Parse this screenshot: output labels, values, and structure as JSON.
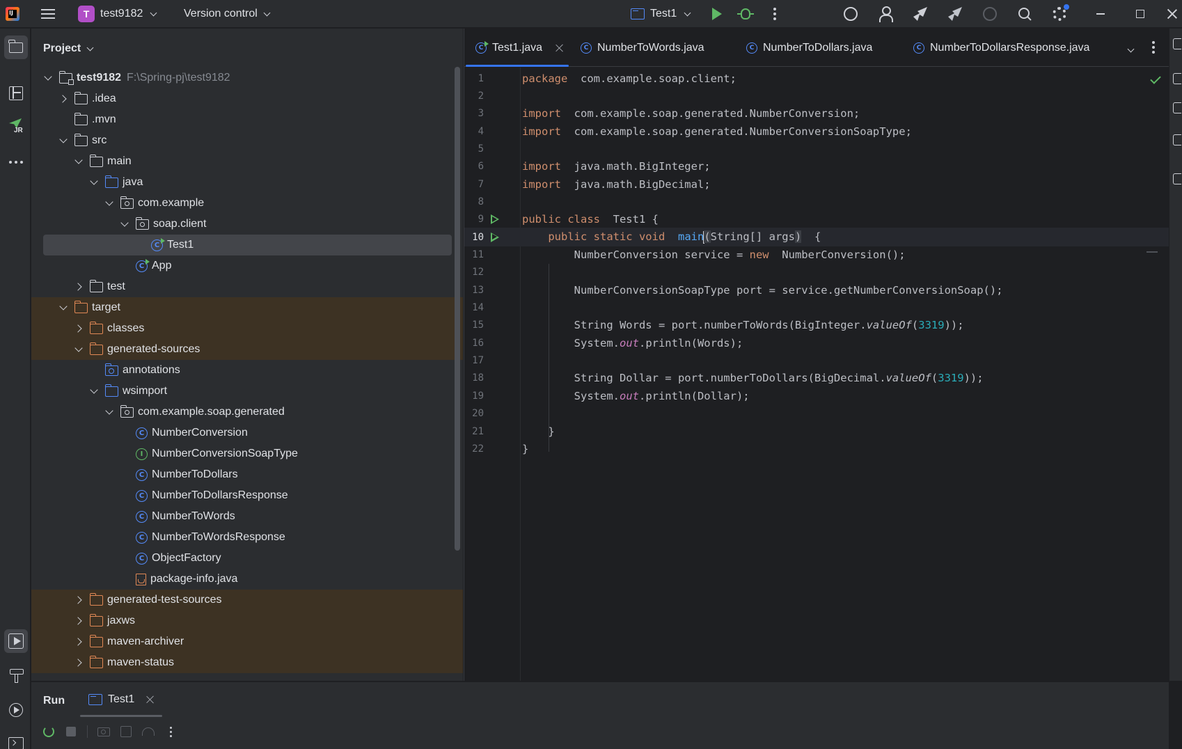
{
  "titlebar": {
    "project_initial": "T",
    "project_name": "test9182",
    "vcs_label": "Version control",
    "run_config": "Test1"
  },
  "project_panel": {
    "title": "Project",
    "tree": [
      {
        "label": "test9182",
        "path": "F:\\Spring-pj\\test9182",
        "depth": 0,
        "arrow": "down",
        "icon": "project-folder",
        "bold": true
      },
      {
        "label": ".idea",
        "depth": 1,
        "arrow": "right",
        "icon": "folder"
      },
      {
        "label": ".mvn",
        "depth": 1,
        "arrow": "none",
        "icon": "folder"
      },
      {
        "label": "src",
        "depth": 1,
        "arrow": "down",
        "icon": "folder"
      },
      {
        "label": "main",
        "depth": 2,
        "arrow": "down",
        "icon": "folder"
      },
      {
        "label": "java",
        "depth": 3,
        "arrow": "down",
        "icon": "source-folder"
      },
      {
        "label": "com.example",
        "depth": 4,
        "arrow": "down",
        "icon": "package"
      },
      {
        "label": "soap.client",
        "depth": 5,
        "arrow": "down",
        "icon": "package"
      },
      {
        "label": "Test1",
        "depth": 6,
        "arrow": "none",
        "icon": "main-class",
        "selected": true
      },
      {
        "label": "App",
        "depth": 5,
        "arrow": "none",
        "icon": "main-class"
      },
      {
        "label": "test",
        "depth": 2,
        "arrow": "right",
        "icon": "folder"
      },
      {
        "label": "target",
        "depth": 1,
        "arrow": "down",
        "icon": "excluded-folder",
        "excluded": true
      },
      {
        "label": "classes",
        "depth": 2,
        "arrow": "right",
        "icon": "excluded-folder",
        "excluded": true
      },
      {
        "label": "generated-sources",
        "depth": 2,
        "arrow": "down",
        "icon": "excluded-folder",
        "excluded": true
      },
      {
        "label": "annotations",
        "depth": 3,
        "arrow": "none",
        "icon": "annotation-folder"
      },
      {
        "label": "wsimport",
        "depth": 3,
        "arrow": "down",
        "icon": "source-folder"
      },
      {
        "label": "com.example.soap.generated",
        "depth": 4,
        "arrow": "down",
        "icon": "package"
      },
      {
        "label": "NumberConversion",
        "depth": 5,
        "arrow": "none",
        "icon": "class"
      },
      {
        "label": "NumberConversionSoapType",
        "depth": 5,
        "arrow": "none",
        "icon": "interface"
      },
      {
        "label": "NumberToDollars",
        "depth": 5,
        "arrow": "none",
        "icon": "class"
      },
      {
        "label": "NumberToDollarsResponse",
        "depth": 5,
        "arrow": "none",
        "icon": "class"
      },
      {
        "label": "NumberToWords",
        "depth": 5,
        "arrow": "none",
        "icon": "class"
      },
      {
        "label": "NumberToWordsResponse",
        "depth": 5,
        "arrow": "none",
        "icon": "class"
      },
      {
        "label": "ObjectFactory",
        "depth": 5,
        "arrow": "none",
        "icon": "class"
      },
      {
        "label": "package-info.java",
        "depth": 5,
        "arrow": "none",
        "icon": "java-file"
      },
      {
        "label": "generated-test-sources",
        "depth": 2,
        "arrow": "right",
        "icon": "excluded-folder",
        "excluded": true
      },
      {
        "label": "jaxws",
        "depth": 2,
        "arrow": "right",
        "icon": "excluded-folder",
        "excluded": true
      },
      {
        "label": "maven-archiver",
        "depth": 2,
        "arrow": "right",
        "icon": "excluded-folder",
        "excluded": true
      },
      {
        "label": "maven-status",
        "depth": 2,
        "arrow": "right",
        "icon": "excluded-folder",
        "excluded": true
      }
    ]
  },
  "editor": {
    "tabs": [
      {
        "label": "Test1.java",
        "active": true,
        "closable": true
      },
      {
        "label": "NumberToWords.java",
        "active": false
      },
      {
        "label": "NumberToDollars.java",
        "active": false
      },
      {
        "label": "NumberToDollarsResponse.java",
        "active": false
      }
    ],
    "current_line": 10,
    "lines": [
      {
        "n": "1",
        "tokens": [
          [
            "kw",
            "package"
          ],
          [
            "",
            "  com.example.soap.client;"
          ]
        ]
      },
      {
        "n": "2",
        "tokens": []
      },
      {
        "n": "3",
        "tokens": [
          [
            "kw",
            "import"
          ],
          [
            "",
            "  com.example.soap.generated.NumberConversion;"
          ]
        ]
      },
      {
        "n": "4",
        "tokens": [
          [
            "kw",
            "import"
          ],
          [
            "",
            "  com.example.soap.generated.NumberConversionSoapType;"
          ]
        ]
      },
      {
        "n": "5",
        "tokens": []
      },
      {
        "n": "6",
        "tokens": [
          [
            "kw",
            "import"
          ],
          [
            "",
            "  java.math.BigInteger;"
          ]
        ]
      },
      {
        "n": "7",
        "tokens": [
          [
            "kw",
            "import"
          ],
          [
            "",
            "  java.math.BigDecimal;"
          ]
        ]
      },
      {
        "n": "8",
        "tokens": []
      },
      {
        "n": "9",
        "run": true,
        "tokens": [
          [
            "kw",
            "public class"
          ],
          [
            "",
            "  Test1 {"
          ]
        ]
      },
      {
        "n": "10",
        "run": true,
        "tokens": [
          [
            "",
            "    "
          ],
          [
            "kw",
            "public static void"
          ],
          [
            "",
            "  "
          ],
          [
            "mname",
            "main"
          ],
          [
            "caret",
            ""
          ],
          [
            "bracket-hl",
            "("
          ],
          [
            "",
            "String[] args"
          ],
          [
            "bracket-hl",
            ")"
          ],
          [
            "",
            "  {"
          ]
        ]
      },
      {
        "n": "11",
        "tokens": [
          [
            "",
            "        NumberConversion service = "
          ],
          [
            "kw",
            "new"
          ],
          [
            "",
            "  NumberConversion();"
          ]
        ]
      },
      {
        "n": "12",
        "tokens": []
      },
      {
        "n": "13",
        "tokens": [
          [
            "",
            "        NumberConversionSoapType port = service.getNumberConversionSoap();"
          ]
        ]
      },
      {
        "n": "14",
        "tokens": []
      },
      {
        "n": "15",
        "tokens": [
          [
            "",
            "        String Words = port.numberToWords(BigInteger."
          ],
          [
            "italic",
            "valueOf"
          ],
          [
            "",
            "("
          ],
          [
            "num",
            "3319"
          ],
          [
            "",
            "));"
          ]
        ]
      },
      {
        "n": "16",
        "tokens": [
          [
            "",
            "        System."
          ],
          [
            "static-field",
            "out"
          ],
          [
            "",
            ".println(Words);"
          ]
        ]
      },
      {
        "n": "17",
        "tokens": []
      },
      {
        "n": "18",
        "tokens": [
          [
            "",
            "        String Dollar = port.numberToDollars(BigDecimal."
          ],
          [
            "italic",
            "valueOf"
          ],
          [
            "",
            "("
          ],
          [
            "num",
            "3319"
          ],
          [
            "",
            "));"
          ]
        ]
      },
      {
        "n": "19",
        "tokens": [
          [
            "",
            "        System."
          ],
          [
            "static-field",
            "out"
          ],
          [
            "",
            ".println(Dollar);"
          ]
        ]
      },
      {
        "n": "20",
        "tokens": []
      },
      {
        "n": "21",
        "tokens": [
          [
            "",
            "    }"
          ]
        ]
      },
      {
        "n": "22",
        "tokens": [
          [
            "",
            "}"
          ]
        ]
      }
    ]
  },
  "run_panel": {
    "title": "Run",
    "tab_label": "Test1"
  },
  "colors": {
    "background": "#1e1f22",
    "panel": "#2b2d30",
    "accent": "#3574f0",
    "keyword": "#cf8e6d",
    "number": "#2aacb8",
    "method": "#56a8f5",
    "static_field": "#c77dbb",
    "run_green": "#5fb865",
    "excluded_bg": "#3d3223"
  }
}
